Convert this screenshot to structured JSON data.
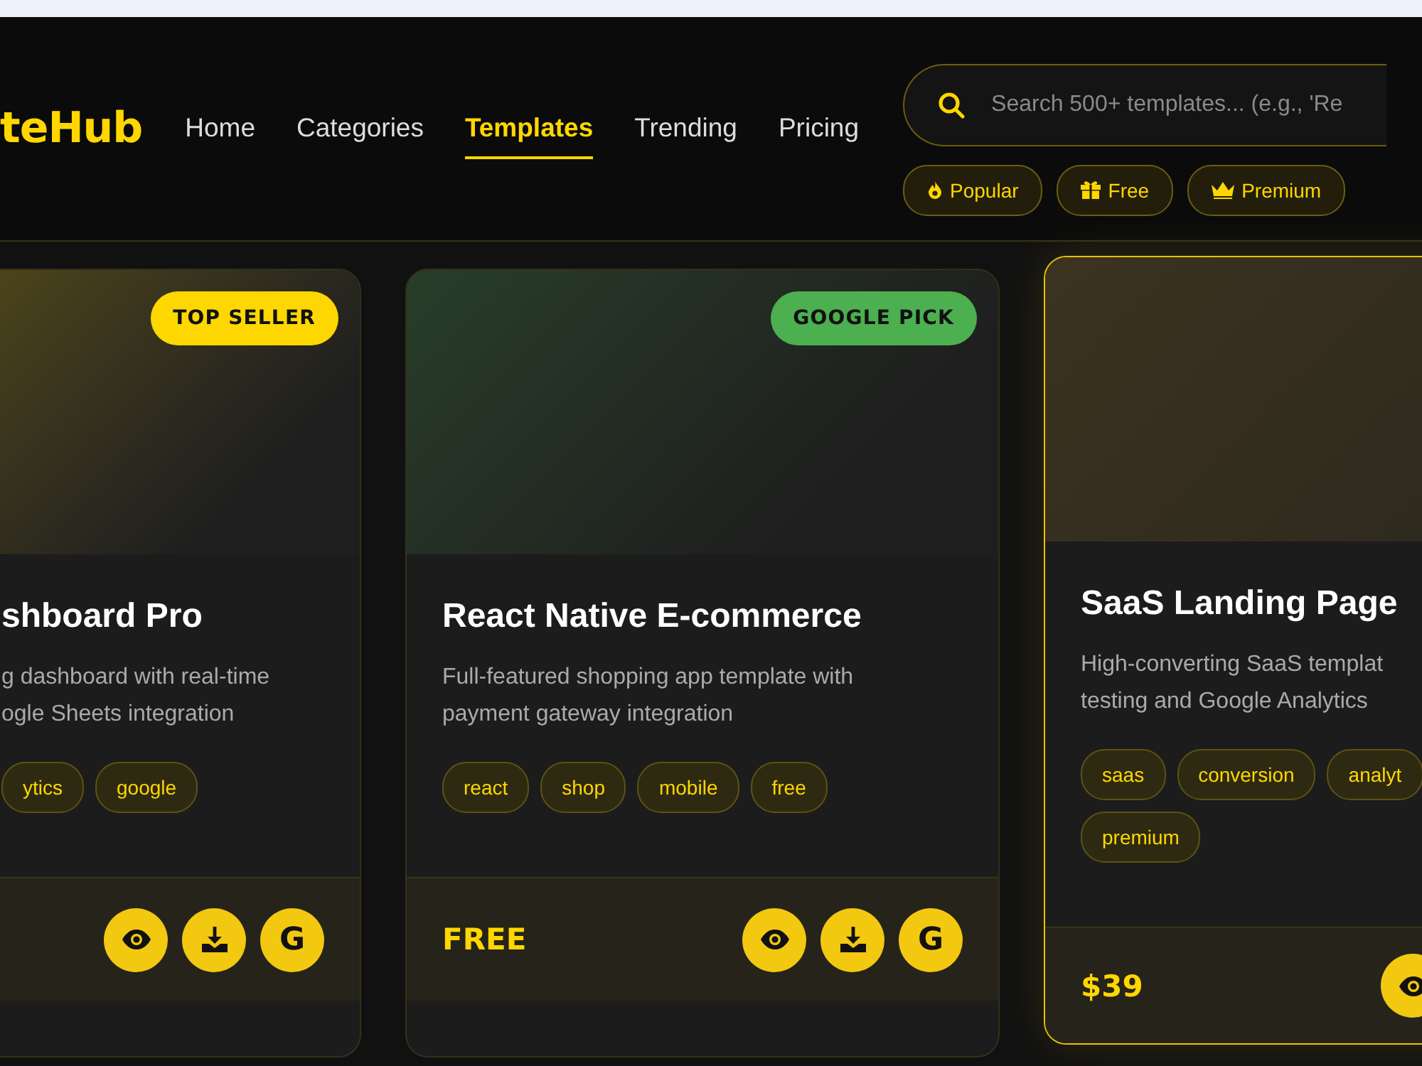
{
  "logo": "teHub",
  "nav": [
    {
      "label": "Home",
      "selected": false
    },
    {
      "label": "Categories",
      "selected": false
    },
    {
      "label": "Templates",
      "selected": true
    },
    {
      "label": "Trending",
      "selected": false
    },
    {
      "label": "Pricing",
      "selected": false
    }
  ],
  "search": {
    "placeholder": "Search 500+ templates... (e.g., 'Re"
  },
  "filters": [
    {
      "label": "Popular",
      "kind": "flame"
    },
    {
      "label": "Free",
      "kind": "gift"
    },
    {
      "label": "Premium",
      "kind": "crown"
    }
  ],
  "cards": [
    {
      "badge": {
        "text": "TOP SELLER",
        "color": "#ffd700"
      },
      "featured": false,
      "title": "shboard Pro",
      "description_lines": [
        "g dashboard with real-time",
        "ogle Sheets integration"
      ],
      "tags": [
        "ytics",
        "google"
      ],
      "actions": [
        {
          "kind": "view"
        },
        {
          "kind": "download"
        },
        {
          "kind": "google",
          "text": "G"
        }
      ]
    },
    {
      "badge": {
        "text": "GOOGLE PICK",
        "color": "#4caf50"
      },
      "featured": false,
      "title": "React Native E-commerce",
      "description_lines": [
        "Full-featured shopping app template with",
        "payment gateway integration"
      ],
      "tags": [
        "react",
        "shop",
        "mobile",
        "free"
      ],
      "price": "FREE",
      "actions": [
        {
          "kind": "view"
        },
        {
          "kind": "download"
        },
        {
          "kind": "google",
          "text": "G"
        }
      ]
    },
    {
      "featured": true,
      "title": "SaaS Landing Page",
      "description_lines": [
        "High-converting SaaS templat",
        "testing and Google Analytics"
      ],
      "tags": [
        "saas",
        "conversion",
        "analyt",
        "premium"
      ],
      "price": "$39",
      "actions": [
        {
          "kind": "view"
        }
      ]
    }
  ]
}
